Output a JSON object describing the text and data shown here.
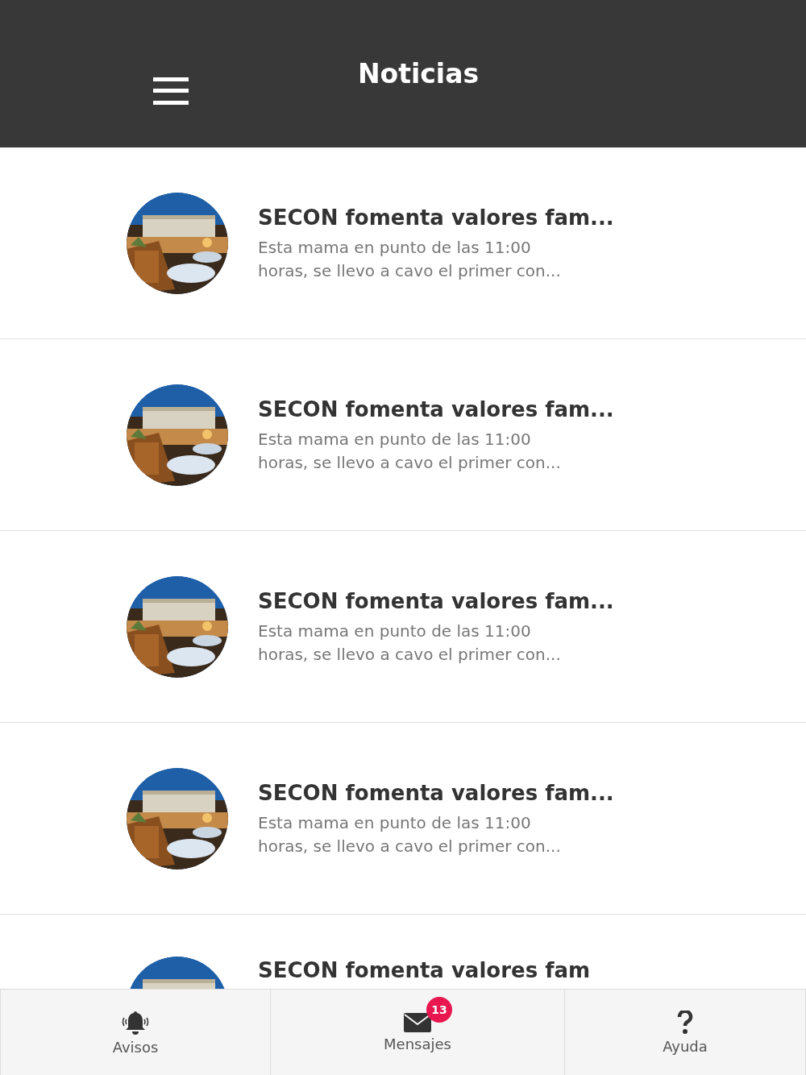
{
  "header": {
    "title": "Noticias"
  },
  "news": [
    {
      "title": "SECON fomenta valores fam...",
      "summary": "Esta mama en punto de las 11:00 horas, se llevo a cavo el primer con..."
    },
    {
      "title": "SECON fomenta valores fam...",
      "summary": "Esta mama en punto de las 11:00 horas, se llevo a cavo el primer con..."
    },
    {
      "title": "SECON fomenta valores fam...",
      "summary": "Esta mama en punto de las 11:00 horas, se llevo a cavo el primer con..."
    },
    {
      "title": "SECON fomenta valores fam...",
      "summary": "Esta mama en punto de las 11:00 horas, se llevo a cavo el primer con..."
    },
    {
      "title": "SECON fomenta valores fam"
    }
  ],
  "tab_bar": [
    {
      "kind": "bell",
      "label": "Avisos"
    },
    {
      "kind": "mail",
      "label": "Mensajes",
      "badge": "13"
    },
    {
      "kind": "help",
      "label": "Ayuda"
    }
  ]
}
